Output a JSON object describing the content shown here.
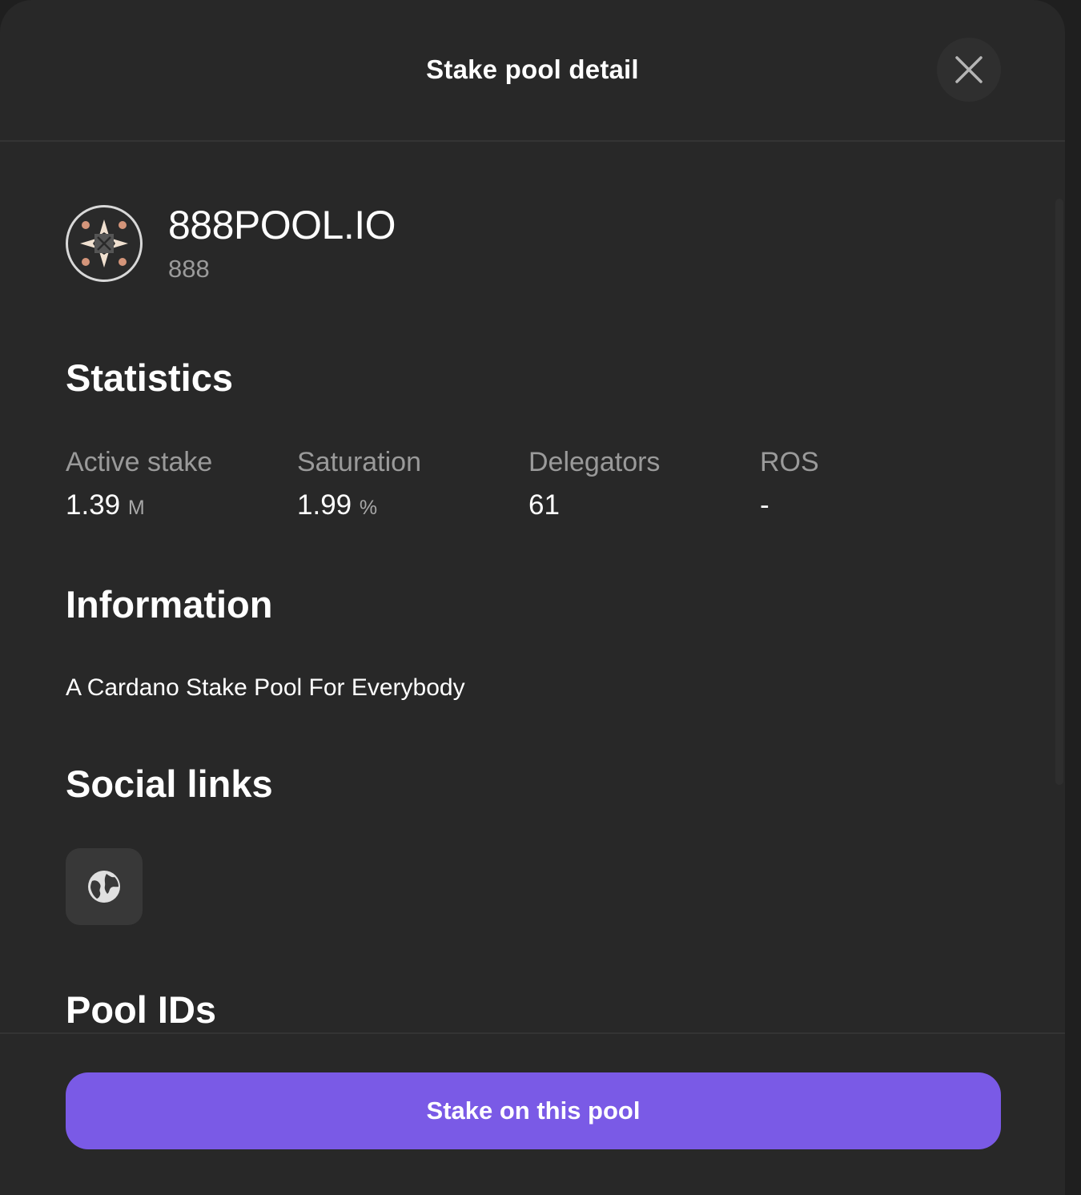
{
  "header": {
    "title": "Stake pool detail",
    "close_icon": "close-icon"
  },
  "pool": {
    "name": "888POOL.IO",
    "ticker": "888",
    "logo_icon": "pool-logo",
    "logo_colors": [
      "#d4957a",
      "#f0e0d0",
      "#555555"
    ]
  },
  "statistics": {
    "title": "Statistics",
    "items": [
      {
        "label": "Active stake",
        "value": "1.39",
        "unit": "M"
      },
      {
        "label": "Saturation",
        "value": "1.99",
        "unit": "%"
      },
      {
        "label": "Delegators",
        "value": "61",
        "unit": ""
      },
      {
        "label": "ROS",
        "value": "-",
        "unit": ""
      }
    ]
  },
  "information": {
    "title": "Information",
    "text": "A Cardano Stake Pool For Everybody"
  },
  "social": {
    "title": "Social links",
    "links": [
      {
        "icon": "globe-icon"
      }
    ]
  },
  "pool_ids": {
    "title": "Pool IDs"
  },
  "footer": {
    "stake_label": "Stake on this pool"
  },
  "colors": {
    "background": "#282828",
    "accent": "#7a5ae6",
    "muted_text": "#9a9a9a"
  }
}
